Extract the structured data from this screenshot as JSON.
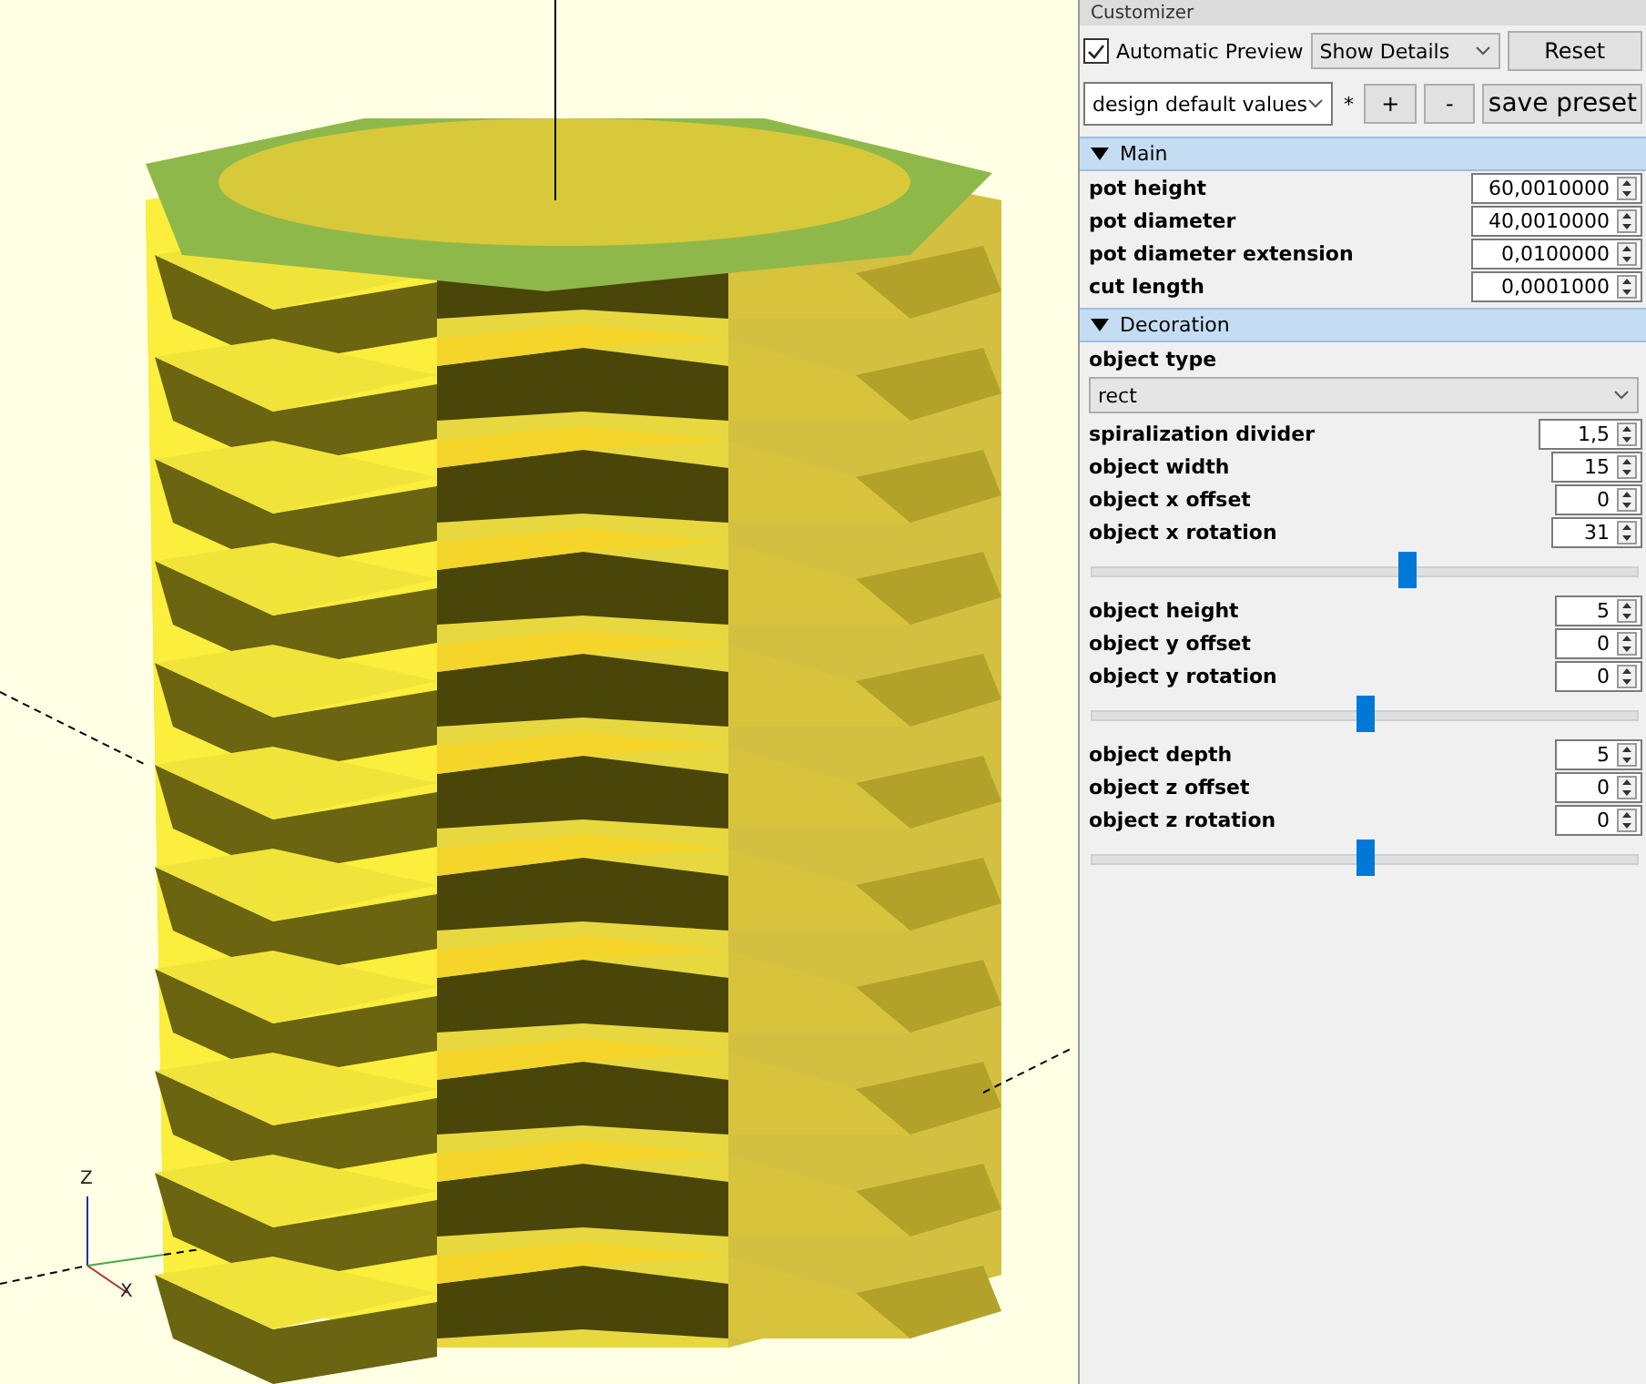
{
  "viewport": {
    "axis_labels": [
      "Z",
      "X"
    ]
  },
  "customizer": {
    "title": "Customizer",
    "automatic_preview": {
      "label": "Automatic Preview",
      "checked": true
    },
    "details_select": {
      "value": "Show Details"
    },
    "reset_button": "Reset",
    "preset_select": {
      "value": "design default values"
    },
    "modified_mark": "*",
    "add_button": "+",
    "remove_button": "-",
    "save_button": "save preset",
    "groups": [
      {
        "title": "Main",
        "expanded": true,
        "params": [
          {
            "kind": "number",
            "label": "pot height",
            "value": "60,0010000"
          },
          {
            "kind": "number",
            "label": "pot diameter",
            "value": "40,0010000"
          },
          {
            "kind": "number",
            "label": "pot diameter extension",
            "value": "0,0100000"
          },
          {
            "kind": "number",
            "label": "cut length",
            "value": "0,0001000"
          }
        ]
      },
      {
        "title": "Decoration",
        "expanded": true,
        "params": [
          {
            "kind": "select",
            "label": "object type",
            "value": "rect"
          },
          {
            "kind": "number",
            "label": "spiralization divider",
            "value": "1,5"
          },
          {
            "kind": "number",
            "label": "object width",
            "value": "15"
          },
          {
            "kind": "number",
            "label": "object x offset",
            "value": "0"
          },
          {
            "kind": "number",
            "label": "object x rotation",
            "value": "31"
          },
          {
            "kind": "slider",
            "level": 0.58
          },
          {
            "kind": "number",
            "label": "object height",
            "value": "5"
          },
          {
            "kind": "number",
            "label": "object y offset",
            "value": "0"
          },
          {
            "kind": "number",
            "label": "object y rotation",
            "value": "0"
          },
          {
            "kind": "slider",
            "level": 0.5
          },
          {
            "kind": "number",
            "label": "object depth",
            "value": "5"
          },
          {
            "kind": "number",
            "label": "object z offset",
            "value": "0"
          },
          {
            "kind": "number",
            "label": "object z rotation",
            "value": "0"
          },
          {
            "kind": "slider",
            "level": 0.5
          }
        ]
      }
    ]
  }
}
